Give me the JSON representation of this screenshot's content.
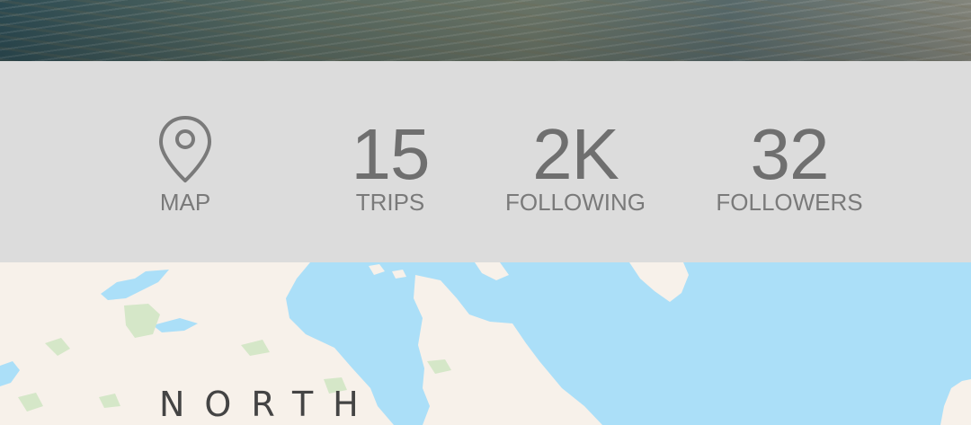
{
  "cover": {
    "icon": "water-photo"
  },
  "stats": {
    "map": {
      "label": "MAP",
      "icon": "map-pin-icon"
    },
    "trips": {
      "value": "15",
      "label": "TRIPS"
    },
    "following": {
      "value": "2K",
      "label": "FOLLOWING"
    },
    "followers": {
      "value": "32",
      "label": "FOLLOWERS"
    }
  },
  "map": {
    "region_label": "NORTH",
    "colors": {
      "water": "#abdff8",
      "land": "#f7f1ea",
      "parks": "#d5e7c8"
    }
  },
  "colors": {
    "stats_bg": "#dcdcdc",
    "stats_text": "#767676"
  }
}
